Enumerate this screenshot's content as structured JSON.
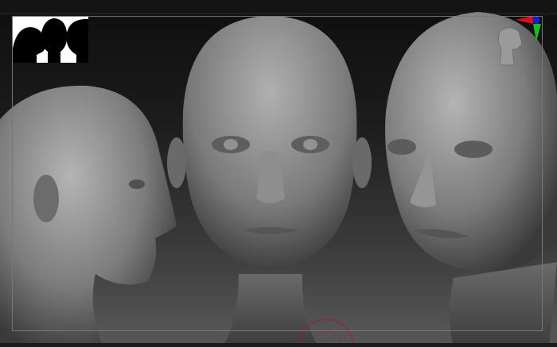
{
  "viewport": {
    "background_top": "#0e0e0e",
    "background_bottom": "#555555",
    "frame_color": "#777777"
  },
  "gizmo": {
    "x_axis_color": "#e01010",
    "y_axis_color": "#10c020",
    "z_axis_color": "#1020e0"
  },
  "brush_cursor_color": "#a02030",
  "model_color": "#8a8a8a"
}
